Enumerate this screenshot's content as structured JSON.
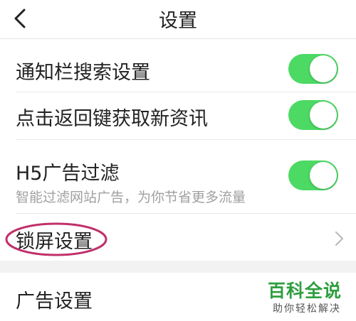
{
  "header": {
    "title": "设置"
  },
  "settings": [
    {
      "label": "通知栏搜索设置",
      "toggle_on": true
    },
    {
      "label": "点击返回键获取新资讯",
      "toggle_on": true
    },
    {
      "label": "H5广告过滤",
      "description": "智能过滤网站广告，为你节省更多流量",
      "toggle_on": true
    },
    {
      "label": "锁屏设置"
    },
    {
      "label": "广告设置"
    }
  ],
  "watermark": {
    "title": "百科全说",
    "subtitle": "助你轻松解决"
  },
  "colors": {
    "toggle_on": "#4cd964",
    "highlight": "#c0306a",
    "watermark": "#2e9e3e"
  }
}
